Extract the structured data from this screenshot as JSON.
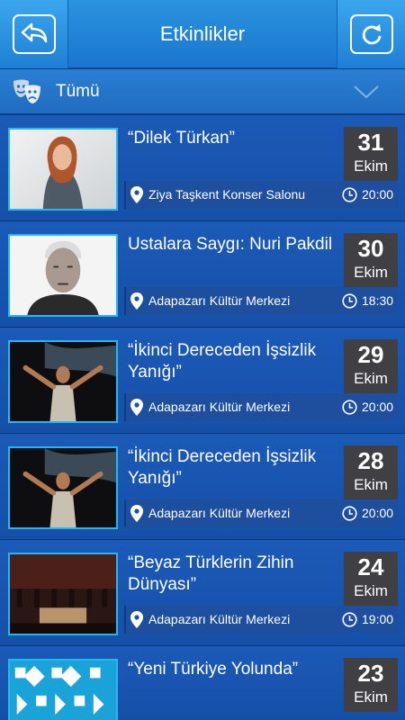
{
  "header": {
    "title": "Etkinlikler"
  },
  "filter": {
    "label": "Tümü"
  },
  "events": [
    {
      "title": "“Dilek Türkan”",
      "day": "31",
      "month": "Ekim",
      "venue": "Ziya Taşkent Konser Salonu",
      "time": "20:00"
    },
    {
      "title": "Ustalara Saygı: Nuri Pakdil",
      "day": "30",
      "month": "Ekim",
      "venue": "Adapazarı Kültür Merkezi",
      "time": "18:30"
    },
    {
      "title": "“İkinci Dereceden İşsizlik Yanığı”",
      "day": "29",
      "month": "Ekim",
      "venue": "Adapazarı Kültür Merkezi",
      "time": "20:00"
    },
    {
      "title": "“İkinci Dereceden İşsizlik Yanığı”",
      "day": "28",
      "month": "Ekim",
      "venue": "Adapazarı Kültür Merkezi",
      "time": "20:00"
    },
    {
      "title": "“Beyaz Türklerin Zihin Dünyası”",
      "day": "24",
      "month": "Ekim",
      "venue": "Adapazarı Kültür Merkezi",
      "time": "19:00"
    },
    {
      "title": "“Yeni Türkiye Yolunda”",
      "day": "23",
      "month": "Ekim",
      "venue": "",
      "time": ""
    }
  ]
}
